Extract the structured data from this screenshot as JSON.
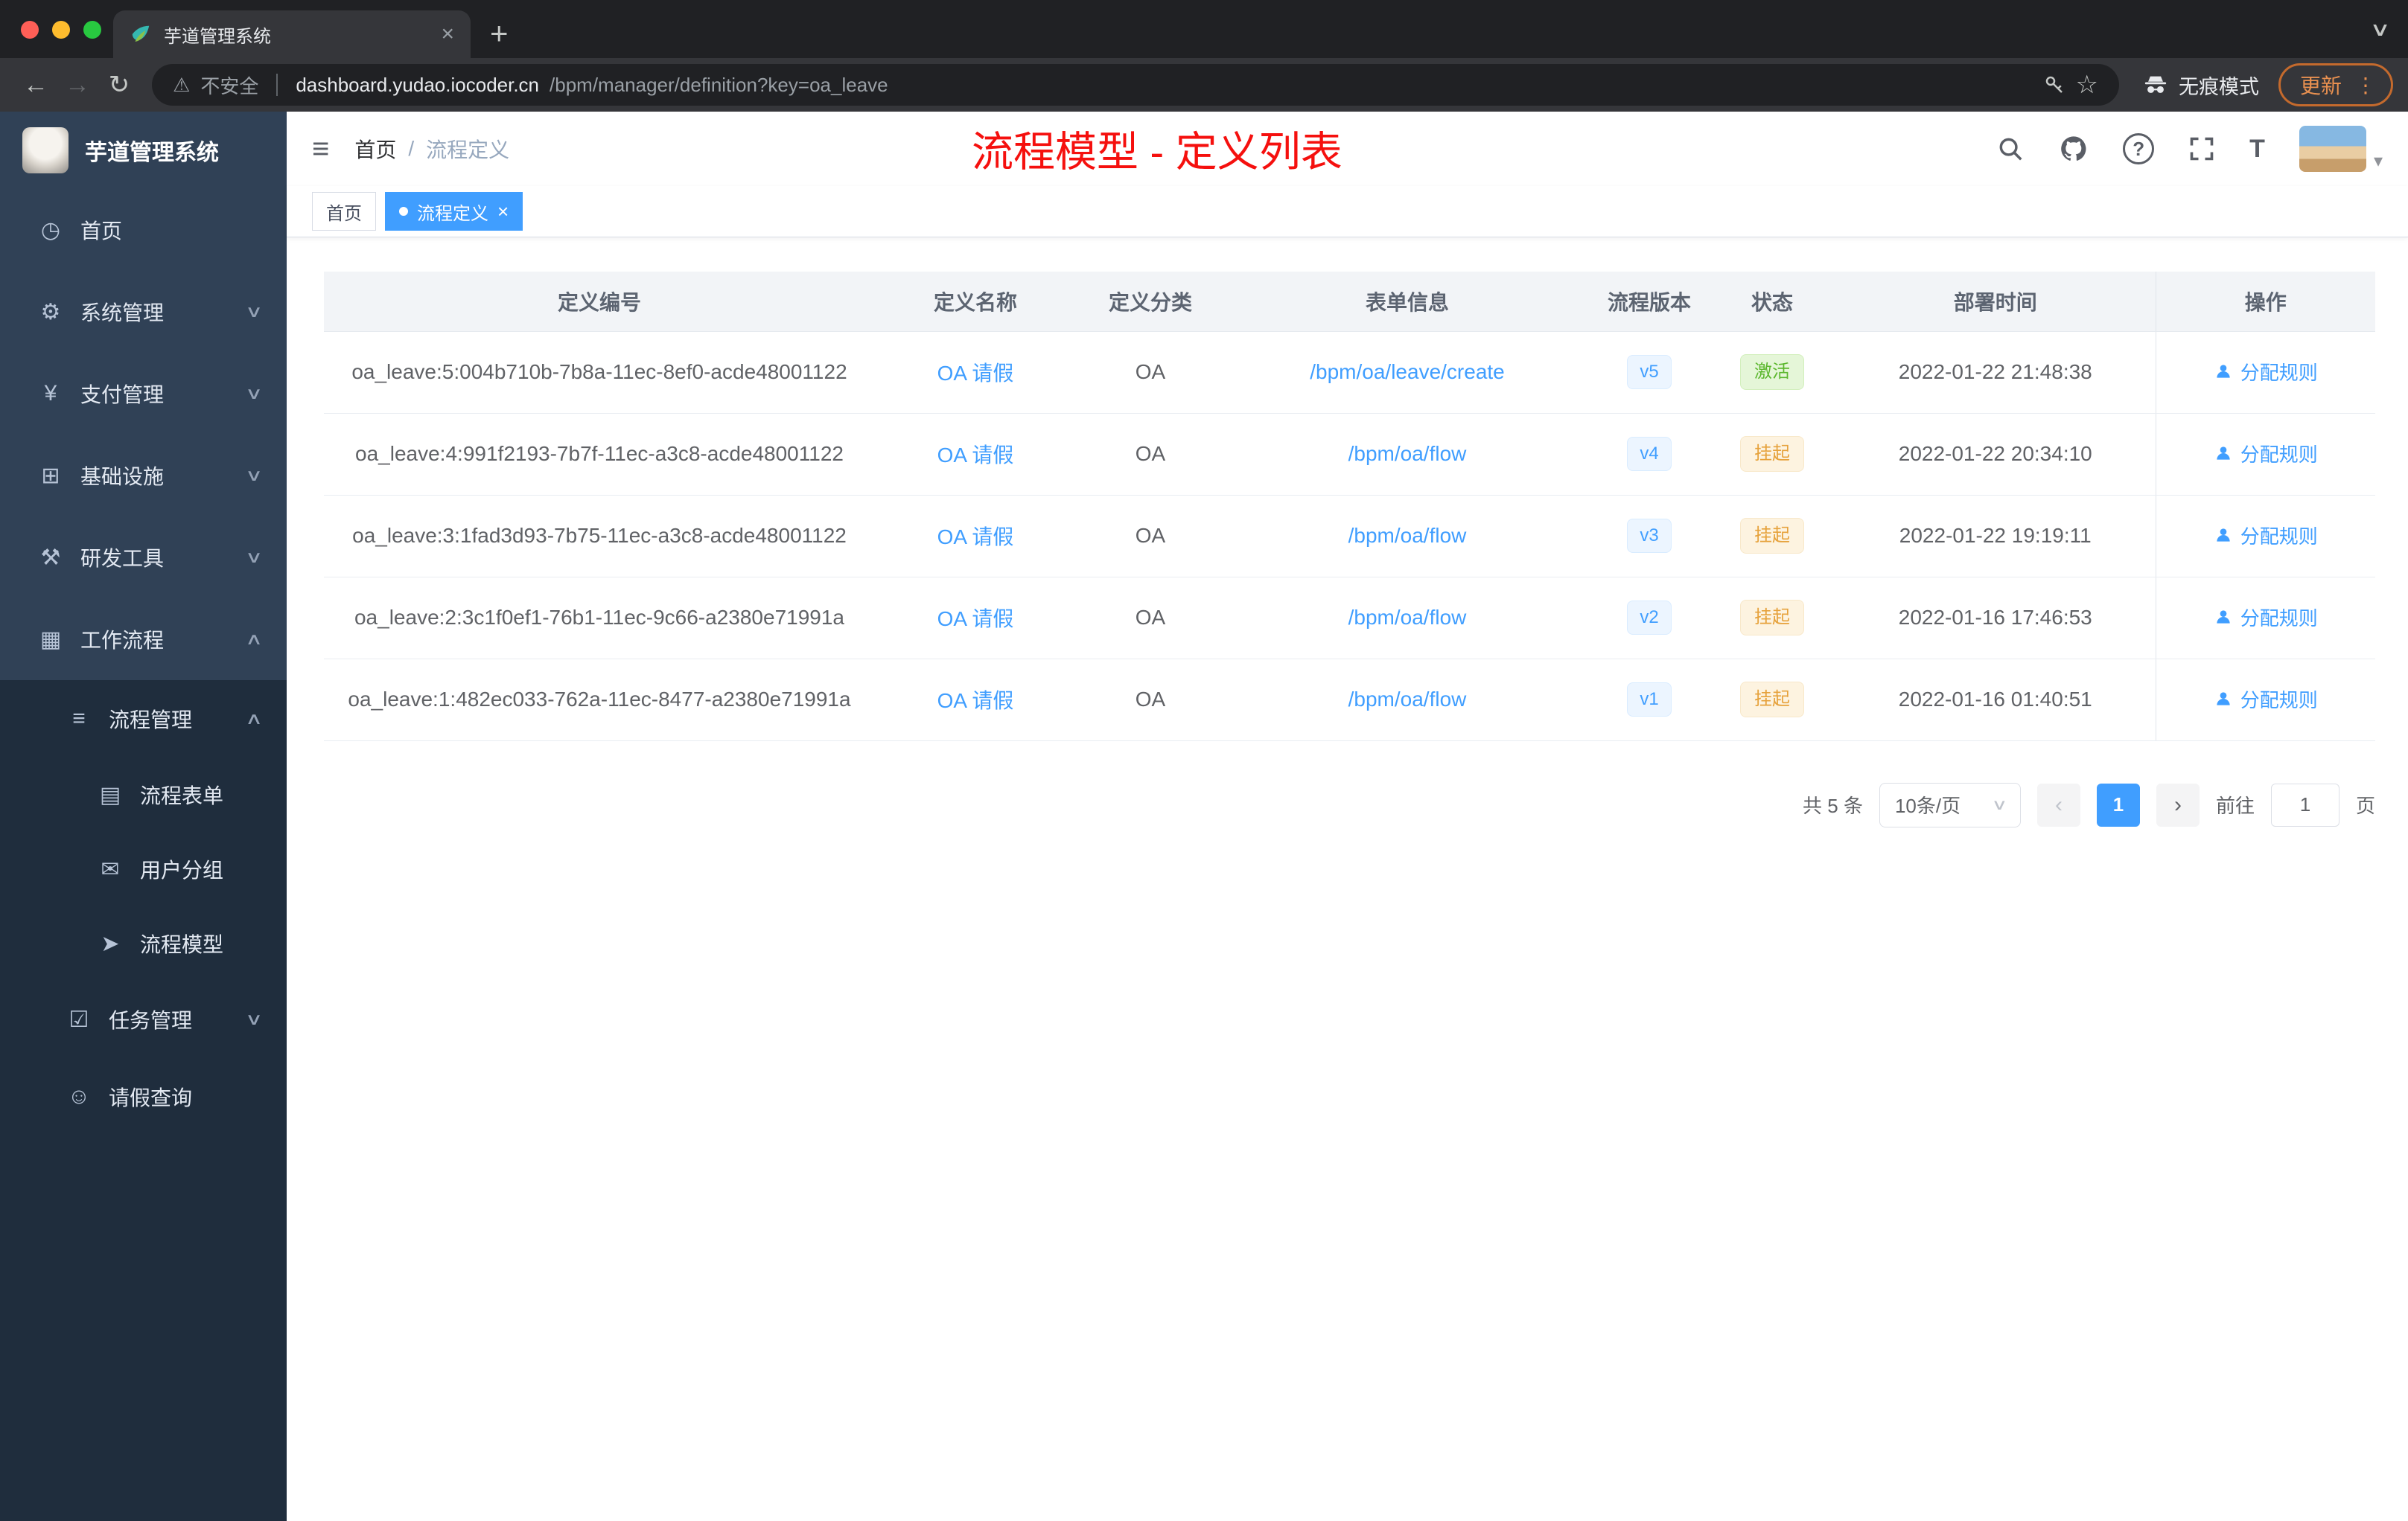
{
  "browser": {
    "tab_title": "芋道管理系统",
    "security_label": "不安全",
    "url_host": "dashboard.yudao.iocoder.cn",
    "url_path": "/bpm/manager/definition?key=oa_leave",
    "incognito_label": "无痕模式",
    "update_label": "更新"
  },
  "icons": {
    "caret_down": "∨",
    "caret_up": "∧",
    "back": "←",
    "forward": "→",
    "reload": "↻",
    "warning": "⚠",
    "star": "☆",
    "menu_dots": "⋮",
    "close": "×",
    "plus": "+",
    "tab_caret": "∨",
    "hamburger": "≡",
    "question": "?",
    "font_size": "T",
    "avatar_caret": "▾"
  },
  "sidebar": {
    "app_title": "芋道管理系统",
    "items": [
      {
        "icon": "◷",
        "label": "首页"
      },
      {
        "icon": "⚙",
        "label": "系统管理"
      },
      {
        "icon": "¥",
        "label": "支付管理"
      },
      {
        "icon": "⊞",
        "label": "基础设施"
      },
      {
        "icon": "⚒",
        "label": "研发工具"
      },
      {
        "icon": "▦",
        "label": "工作流程"
      },
      {
        "icon": "≡",
        "label": "流程管理"
      },
      {
        "icon": "▤",
        "label": "流程表单"
      },
      {
        "icon": "✉",
        "label": "用户分组"
      },
      {
        "icon": "➤",
        "label": "流程模型"
      },
      {
        "icon": "☑",
        "label": "任务管理"
      },
      {
        "icon": "☺",
        "label": "请假查询"
      }
    ]
  },
  "header": {
    "breadcrumb_home": "首页",
    "breadcrumb_sep": "/",
    "breadcrumb_current": "流程定义",
    "annotation": "流程模型 - 定义列表"
  },
  "tags": {
    "home": "首页",
    "current": "流程定义"
  },
  "table": {
    "columns": [
      "定义编号",
      "定义名称",
      "定义分类",
      "表单信息",
      "流程版本",
      "状态",
      "部署时间",
      "操作"
    ],
    "rows": [
      {
        "id": "oa_leave:5:004b710b-7b8a-11ec-8ef0-acde48001122",
        "name": "OA 请假",
        "category": "OA",
        "form": "/bpm/oa/leave/create",
        "version": "v5",
        "status": "激活",
        "time": "2022-01-22 21:48:38",
        "action": "分配规则"
      },
      {
        "id": "oa_leave:4:991f2193-7b7f-11ec-a3c8-acde48001122",
        "name": "OA 请假",
        "category": "OA",
        "form": "/bpm/oa/flow",
        "version": "v4",
        "status": "挂起",
        "time": "2022-01-22 20:34:10",
        "action": "分配规则"
      },
      {
        "id": "oa_leave:3:1fad3d93-7b75-11ec-a3c8-acde48001122",
        "name": "OA 请假",
        "category": "OA",
        "form": "/bpm/oa/flow",
        "version": "v3",
        "status": "挂起",
        "time": "2022-01-22 19:19:11",
        "action": "分配规则"
      },
      {
        "id": "oa_leave:2:3c1f0ef1-76b1-11ec-9c66-a2380e71991a",
        "name": "OA 请假",
        "category": "OA",
        "form": "/bpm/oa/flow",
        "version": "v2",
        "status": "挂起",
        "time": "2022-01-16 17:46:53",
        "action": "分配规则"
      },
      {
        "id": "oa_leave:1:482ec033-762a-11ec-8477-a2380e71991a",
        "name": "OA 请假",
        "category": "OA",
        "form": "/bpm/oa/flow",
        "version": "v1",
        "status": "挂起",
        "time": "2022-01-16 01:40:51",
        "action": "分配规则"
      }
    ]
  },
  "pagination": {
    "total": "共 5 条",
    "page_size": "10条/页",
    "current": "1",
    "goto": "前往",
    "goto_value": "1",
    "unit": "页"
  }
}
